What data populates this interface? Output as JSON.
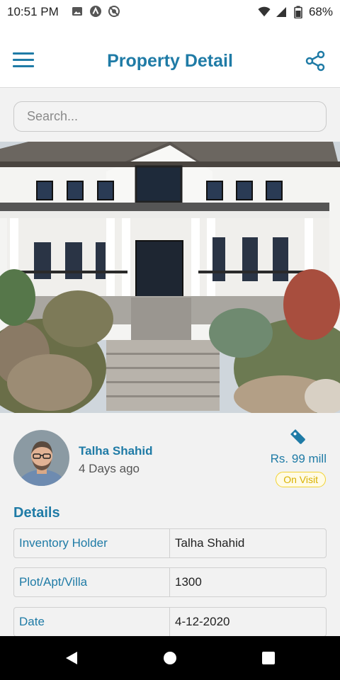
{
  "status_bar": {
    "time": "10:51 PM",
    "battery": "68%",
    "left_icons": [
      "image-icon",
      "app-icon",
      "sync-icon"
    ],
    "right_icons": [
      "wifi-icon",
      "signal-icon",
      "battery-icon"
    ]
  },
  "app_bar": {
    "title": "Property Detail",
    "menu_icon": "hamburger-menu-icon",
    "share_icon": "share-icon"
  },
  "search": {
    "placeholder": "Search...",
    "value": ""
  },
  "agent": {
    "name": "Talha Shahid",
    "posted": "4 Days ago",
    "price": "Rs. 99 mill",
    "status": "On Visit"
  },
  "details": {
    "heading": "Details",
    "rows": [
      {
        "key": "Inventory Holder",
        "value": "Talha Shahid"
      },
      {
        "key": "Plot/Apt/Villa",
        "value": "1300"
      },
      {
        "key": "Date",
        "value": "4-12-2020"
      }
    ]
  },
  "colors": {
    "accent": "#1f7ba6",
    "badge": "#f2d32f",
    "background": "#f2f2f2"
  }
}
